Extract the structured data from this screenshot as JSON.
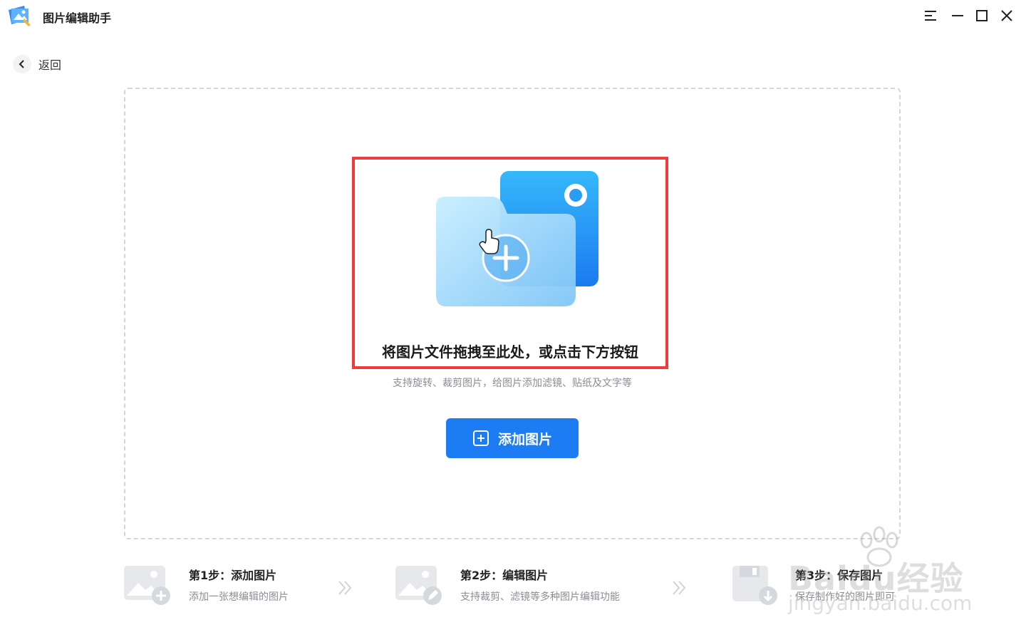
{
  "app": {
    "title": "图片编辑助手"
  },
  "nav": {
    "back_label": "返回"
  },
  "dropzone": {
    "title": "将图片文件拖拽至此处，或点击下方按钮",
    "subtitle": "支持旋转、裁剪图片，给图片添加滤镜、贴纸及文字等",
    "add_button_label": "添加图片"
  },
  "steps": [
    {
      "title": "第1步：添加图片",
      "desc": "添加一张想编辑的图片"
    },
    {
      "title": "第2步：编辑图片",
      "desc": "支持裁剪、滤镜等多种图片编辑功能"
    },
    {
      "title": "第3步：保存图片",
      "desc": "保存制作好的图片即可"
    }
  ],
  "watermark": {
    "brand": "Baidu经验",
    "url": "jingyan.baidu.com"
  },
  "colors": {
    "accent": "#1b7cf4",
    "highlight": "#ee3b3b",
    "dashed_border": "#d3d5d9"
  },
  "icons": {
    "logo": "app-logo-icon",
    "menu": "menu-icon",
    "minimize": "minimize-icon",
    "maximize": "maximize-icon",
    "close": "close-icon",
    "back": "chevron-left-icon",
    "upload": "folder-add-icon",
    "plus": "plus-square-icon"
  }
}
